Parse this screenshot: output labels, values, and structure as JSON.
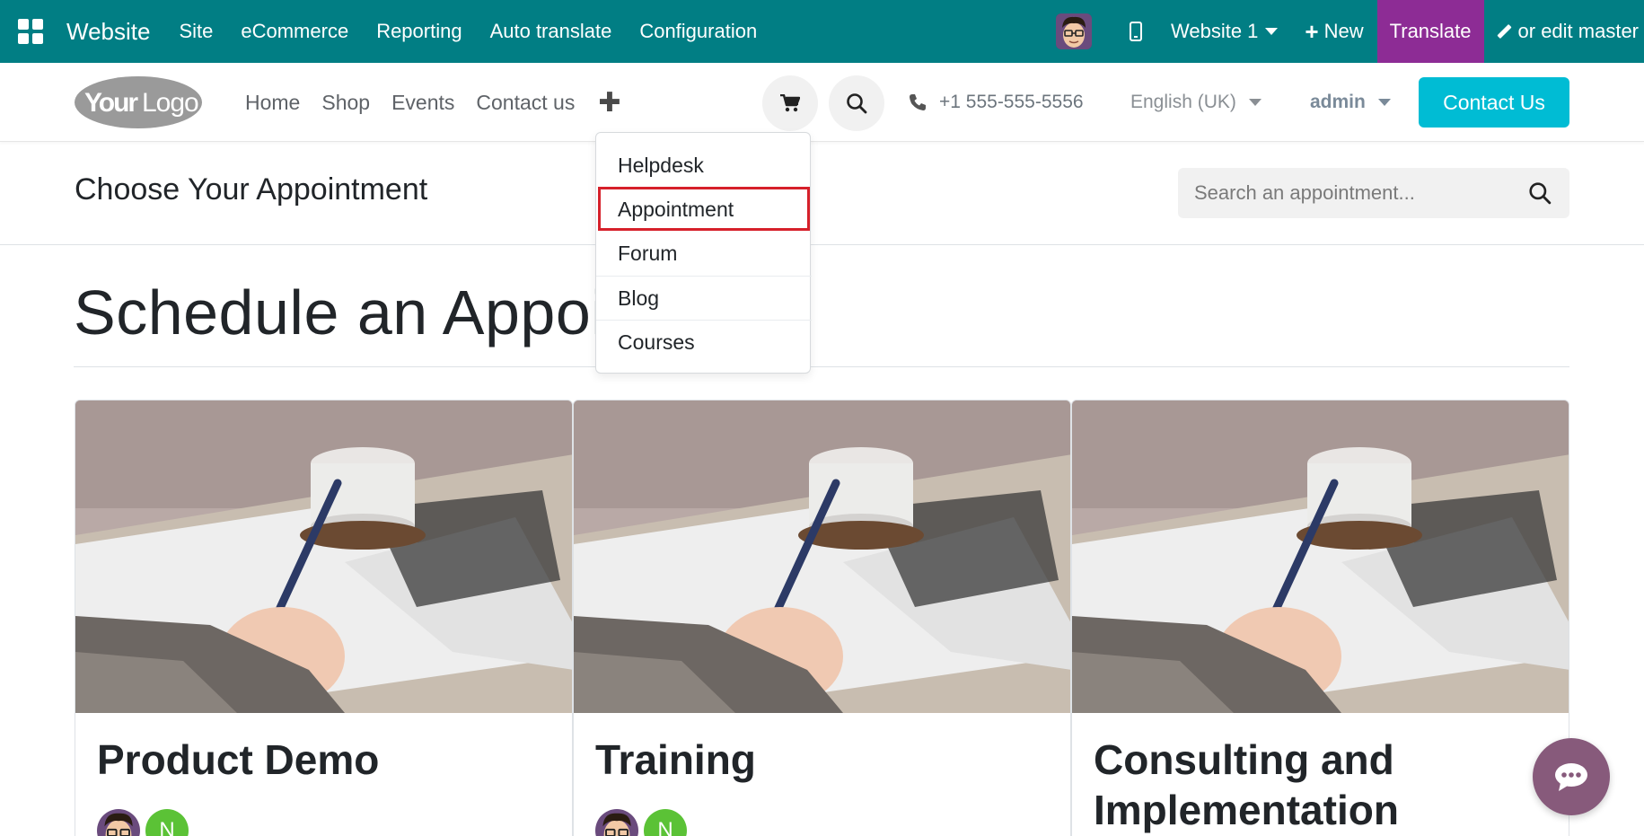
{
  "topbar": {
    "app_name": "Website",
    "menu": [
      "Site",
      "eCommerce",
      "Reporting",
      "Auto translate",
      "Configuration"
    ],
    "website_selector": "Website 1",
    "new_label": "New",
    "translate_label": "Translate",
    "edit_master_label": "or edit master",
    "bg_color": "#017e84",
    "translate_color": "#8d2c95"
  },
  "header": {
    "logo_text_your": "Your",
    "logo_text_logo": "Logo",
    "nav": [
      "Home",
      "Shop",
      "Events",
      "Contact us"
    ],
    "phone": "+1 555-555-5556",
    "language": "English (UK)",
    "user": "admin",
    "contact_button": "Contact Us",
    "accent_color": "#00bcd4"
  },
  "dropdown": {
    "items": [
      "Helpdesk",
      "Appointment",
      "Forum",
      "Blog",
      "Courses"
    ],
    "highlighted": "Appointment",
    "highlight_color": "#d6202a"
  },
  "subheader": {
    "title": "Choose Your Appointment",
    "search_placeholder": "Search an appointment..."
  },
  "main": {
    "heading": "Schedule an Appointment",
    "cards": [
      {
        "title": "Product Demo",
        "avatar_initial": "N"
      },
      {
        "title": "Training",
        "avatar_initial": "N"
      },
      {
        "title": "Consulting and Implementation",
        "avatar_initial": "N"
      }
    ]
  },
  "icons": {
    "apps": "apps-grid-icon",
    "cart": "cart-icon",
    "search": "search-icon",
    "phone": "phone-icon",
    "chat": "chat-bubble-icon"
  }
}
